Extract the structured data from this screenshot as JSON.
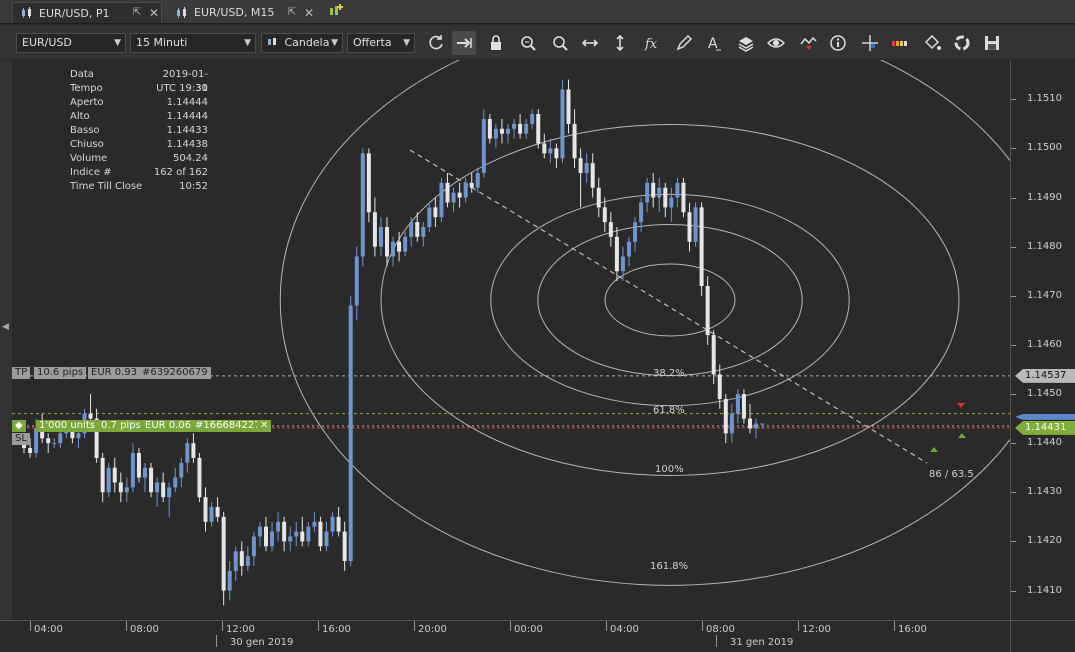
{
  "tabs": [
    {
      "label": "EUR/USD, P1",
      "active": true
    },
    {
      "label": "EUR/USD, M15",
      "active": false
    }
  ],
  "toolbar": {
    "instrument": "EUR/USD",
    "period": "15 Minuti",
    "chart_type": "Candela",
    "offer_side": "Offerta",
    "tools": [
      "refresh-icon",
      "shift-icon",
      "lock-icon",
      "zoom-in-icon",
      "zoom-out-icon",
      "horizontal-expand-icon",
      "vertical-expand-icon",
      "formula-icon",
      "pencil-icon",
      "text-icon",
      "layers-icon",
      "eye-icon",
      "alert-icon",
      "info-icon",
      "crosshair-icon",
      "signal-bars-icon",
      "paint-bucket-icon",
      "recycle-icon",
      "save-icon"
    ]
  },
  "info_panel": [
    {
      "key": "Data",
      "value": "2019-01-31"
    },
    {
      "key": "Tempo",
      "value": "UTC 19:30"
    },
    {
      "key": "Aperto",
      "value": "1.14444"
    },
    {
      "key": "Alto",
      "value": "1.14444"
    },
    {
      "key": "Basso",
      "value": "1.14433"
    },
    {
      "key": "Chiuso",
      "value": "1.14438"
    },
    {
      "key": "Volume",
      "value": "504.24"
    },
    {
      "key": "Indice #",
      "value": "162 of 162"
    },
    {
      "key": "Time Till Close",
      "value": "10:52"
    }
  ],
  "orders": {
    "tp": {
      "label": "TP",
      "pips": "10.6 pips",
      "eur": "EUR 0.93",
      "id": "#639260679",
      "price": 1.14537
    },
    "entry": {
      "icon": "diamond-icon",
      "units": "1'000 units",
      "pips": "0.7 pips",
      "eur": "EUR 0.06",
      "id": "#166684227",
      "close": "✕"
    },
    "sl": {
      "label": "SL"
    },
    "entry_line_price": 1.14431,
    "green_line_price": 1.1446
  },
  "fib": {
    "labels": [
      "38.2%",
      "61.8%",
      "100%",
      "161.8%"
    ],
    "trend_label": "86 / 63.5"
  },
  "price_axis": {
    "ticks": [
      "1.1510",
      "1.1500",
      "1.1490",
      "1.1480",
      "1.1470",
      "1.1460",
      "1.1450",
      "1.1440",
      "1.1430",
      "1.1420",
      "1.1410"
    ],
    "labels": [
      {
        "text": "1.14537",
        "kind": "grey"
      },
      {
        "text": "1.14431",
        "kind": "green"
      }
    ]
  },
  "time_axis": {
    "ticks": [
      "04:00",
      "08:00",
      "12:00",
      "16:00",
      "20:00",
      "00:00",
      "04:00",
      "08:00",
      "12:00",
      "16:00"
    ],
    "dates": [
      "30 gen 2019",
      "31 gen 2019"
    ]
  },
  "chart_data": {
    "type": "candlestick",
    "ylim": [
      1.1404,
      1.1518
    ],
    "colors": {
      "up": "#6f95cf",
      "down": "#e6e6e6",
      "background": "#2a2a2a",
      "fib": "#cfcfcf"
    },
    "candles": [
      [
        1.144,
        1.1442,
        1.1438,
        1.1439
      ],
      [
        1.1439,
        1.1441,
        1.1437,
        1.1438
      ],
      [
        1.1438,
        1.1445,
        1.1437,
        1.1443
      ],
      [
        1.1443,
        1.1446,
        1.144,
        1.1441
      ],
      [
        1.1441,
        1.1442,
        1.1438,
        1.144
      ],
      [
        1.144,
        1.1441,
        1.1439,
        1.144
      ],
      [
        1.144,
        1.1443,
        1.1439,
        1.1442
      ],
      [
        1.1442,
        1.1444,
        1.1441,
        1.1443
      ],
      [
        1.1443,
        1.1444,
        1.144,
        1.1441
      ],
      [
        1.1441,
        1.1443,
        1.1439,
        1.1442
      ],
      [
        1.1442,
        1.1447,
        1.1441,
        1.1446
      ],
      [
        1.1446,
        1.145,
        1.1444,
        1.1445
      ],
      [
        1.1445,
        1.1447,
        1.1436,
        1.1437
      ],
      [
        1.1437,
        1.1438,
        1.1428,
        1.143
      ],
      [
        1.143,
        1.1436,
        1.1429,
        1.1435
      ],
      [
        1.1435,
        1.1437,
        1.143,
        1.1432
      ],
      [
        1.1432,
        1.1434,
        1.1428,
        1.143
      ],
      [
        1.143,
        1.1433,
        1.1428,
        1.1431
      ],
      [
        1.1431,
        1.144,
        1.143,
        1.1438
      ],
      [
        1.1438,
        1.1439,
        1.1432,
        1.1433
      ],
      [
        1.1433,
        1.1436,
        1.143,
        1.1435
      ],
      [
        1.1435,
        1.1436,
        1.1429,
        1.143
      ],
      [
        1.143,
        1.1433,
        1.1427,
        1.1432
      ],
      [
        1.1432,
        1.1434,
        1.1428,
        1.1429
      ],
      [
        1.1429,
        1.1432,
        1.1425,
        1.1431
      ],
      [
        1.1431,
        1.1435,
        1.143,
        1.1433
      ],
      [
        1.1433,
        1.1437,
        1.1431,
        1.1436
      ],
      [
        1.1436,
        1.1441,
        1.1434,
        1.144
      ],
      [
        1.144,
        1.1442,
        1.1436,
        1.1437
      ],
      [
        1.1437,
        1.1438,
        1.1428,
        1.1429
      ],
      [
        1.1429,
        1.1431,
        1.1422,
        1.1424
      ],
      [
        1.1424,
        1.1428,
        1.1423,
        1.1427
      ],
      [
        1.1427,
        1.1429,
        1.1424,
        1.1425
      ],
      [
        1.1425,
        1.1426,
        1.1407,
        1.141
      ],
      [
        1.141,
        1.1416,
        1.1408,
        1.1414
      ],
      [
        1.1414,
        1.1419,
        1.1412,
        1.1418
      ],
      [
        1.1418,
        1.142,
        1.1413,
        1.1415
      ],
      [
        1.1415,
        1.1419,
        1.1414,
        1.1417
      ],
      [
        1.1417,
        1.1422,
        1.1415,
        1.1421
      ],
      [
        1.1421,
        1.1424,
        1.1419,
        1.1423
      ],
      [
        1.1423,
        1.1425,
        1.1418,
        1.1419
      ],
      [
        1.1419,
        1.1424,
        1.1418,
        1.1422
      ],
      [
        1.1422,
        1.1426,
        1.142,
        1.1424
      ],
      [
        1.1424,
        1.1425,
        1.1418,
        1.142
      ],
      [
        1.142,
        1.1423,
        1.1418,
        1.1421
      ],
      [
        1.1421,
        1.1424,
        1.1419,
        1.1422
      ],
      [
        1.1422,
        1.1425,
        1.1419,
        1.142
      ],
      [
        1.142,
        1.1424,
        1.1419,
        1.1423
      ],
      [
        1.1423,
        1.1426,
        1.1422,
        1.1424
      ],
      [
        1.1424,
        1.1425,
        1.1418,
        1.1419
      ],
      [
        1.1419,
        1.1424,
        1.1418,
        1.1422
      ],
      [
        1.1422,
        1.1426,
        1.1421,
        1.1425
      ],
      [
        1.1425,
        1.1427,
        1.1421,
        1.1422
      ],
      [
        1.1422,
        1.1424,
        1.1414,
        1.1416
      ],
      [
        1.1416,
        1.147,
        1.1415,
        1.1468
      ],
      [
        1.1468,
        1.148,
        1.1465,
        1.1478
      ],
      [
        1.1478,
        1.15,
        1.1476,
        1.1499
      ],
      [
        1.1499,
        1.15,
        1.1485,
        1.1487
      ],
      [
        1.1487,
        1.149,
        1.1478,
        1.148
      ],
      [
        1.148,
        1.1486,
        1.1478,
        1.1484
      ],
      [
        1.1484,
        1.1486,
        1.1476,
        1.1478
      ],
      [
        1.1478,
        1.1482,
        1.1476,
        1.1481
      ],
      [
        1.1481,
        1.1483,
        1.1477,
        1.1479
      ],
      [
        1.1479,
        1.1483,
        1.1478,
        1.1482
      ],
      [
        1.1482,
        1.1486,
        1.148,
        1.1485
      ],
      [
        1.1485,
        1.1487,
        1.1481,
        1.1482
      ],
      [
        1.1482,
        1.1485,
        1.148,
        1.1484
      ],
      [
        1.1484,
        1.1489,
        1.1483,
        1.1488
      ],
      [
        1.1488,
        1.149,
        1.1484,
        1.1486
      ],
      [
        1.1486,
        1.1494,
        1.1485,
        1.1493
      ],
      [
        1.1493,
        1.1495,
        1.1488,
        1.1489
      ],
      [
        1.1489,
        1.1492,
        1.1487,
        1.1491
      ],
      [
        1.1491,
        1.1493,
        1.1488,
        1.149
      ],
      [
        1.149,
        1.1494,
        1.1489,
        1.1493
      ],
      [
        1.1493,
        1.1495,
        1.1491,
        1.1492
      ],
      [
        1.1492,
        1.1496,
        1.1491,
        1.1495
      ],
      [
        1.1495,
        1.1508,
        1.1494,
        1.1506
      ],
      [
        1.1506,
        1.1507,
        1.1501,
        1.1502
      ],
      [
        1.1502,
        1.1505,
        1.15,
        1.1504
      ],
      [
        1.1504,
        1.1506,
        1.1501,
        1.1503
      ],
      [
        1.1503,
        1.1505,
        1.1501,
        1.1504
      ],
      [
        1.1504,
        1.1506,
        1.1502,
        1.1505
      ],
      [
        1.1505,
        1.1507,
        1.1502,
        1.1503
      ],
      [
        1.1503,
        1.1506,
        1.1502,
        1.1505
      ],
      [
        1.1505,
        1.1508,
        1.1504,
        1.1507
      ],
      [
        1.1507,
        1.1508,
        1.15,
        1.1501
      ],
      [
        1.1501,
        1.1503,
        1.1498,
        1.1499
      ],
      [
        1.1499,
        1.1502,
        1.1497,
        1.15
      ],
      [
        1.15,
        1.1501,
        1.1496,
        1.1498
      ],
      [
        1.1498,
        1.1514,
        1.1497,
        1.1512
      ],
      [
        1.1512,
        1.1514,
        1.1503,
        1.1505
      ],
      [
        1.1505,
        1.1508,
        1.1496,
        1.1498
      ],
      [
        1.1498,
        1.15,
        1.1488,
        1.1495
      ],
      [
        1.1495,
        1.1499,
        1.1493,
        1.1497
      ],
      [
        1.1497,
        1.1499,
        1.149,
        1.1492
      ],
      [
        1.1492,
        1.1494,
        1.1486,
        1.1488
      ],
      [
        1.1488,
        1.149,
        1.1483,
        1.1485
      ],
      [
        1.1485,
        1.1487,
        1.148,
        1.1482
      ],
      [
        1.1482,
        1.1484,
        1.1473,
        1.1475
      ],
      [
        1.1475,
        1.148,
        1.1473,
        1.1478
      ],
      [
        1.1478,
        1.1482,
        1.1476,
        1.1481
      ],
      [
        1.1481,
        1.1486,
        1.1479,
        1.1485
      ],
      [
        1.1485,
        1.149,
        1.1483,
        1.1489
      ],
      [
        1.1489,
        1.1494,
        1.1487,
        1.1493
      ],
      [
        1.1493,
        1.1495,
        1.1488,
        1.149
      ],
      [
        1.149,
        1.1494,
        1.1487,
        1.1492
      ],
      [
        1.1492,
        1.1493,
        1.1486,
        1.1488
      ],
      [
        1.1488,
        1.1492,
        1.1485,
        1.149
      ],
      [
        1.149,
        1.1494,
        1.1488,
        1.1493
      ],
      [
        1.1493,
        1.1494,
        1.1486,
        1.1487
      ],
      [
        1.1487,
        1.1489,
        1.1479,
        1.1481
      ],
      [
        1.1481,
        1.1489,
        1.148,
        1.1488
      ],
      [
        1.1488,
        1.1489,
        1.147,
        1.1472
      ],
      [
        1.1472,
        1.1474,
        1.146,
        1.1462
      ],
      [
        1.1462,
        1.1463,
        1.1452,
        1.1454
      ],
      [
        1.1454,
        1.1456,
        1.1447,
        1.1449
      ],
      [
        1.1449,
        1.145,
        1.144,
        1.1442
      ],
      [
        1.1442,
        1.1448,
        1.144,
        1.1446
      ],
      [
        1.1446,
        1.1451,
        1.1444,
        1.145
      ],
      [
        1.145,
        1.1451,
        1.1444,
        1.1445
      ],
      [
        1.1445,
        1.1448,
        1.1442,
        1.1443
      ],
      [
        1.1443,
        1.1445,
        1.1441,
        1.1444
      ],
      [
        1.1444,
        1.1444,
        1.1443,
        1.1444
      ]
    ]
  }
}
